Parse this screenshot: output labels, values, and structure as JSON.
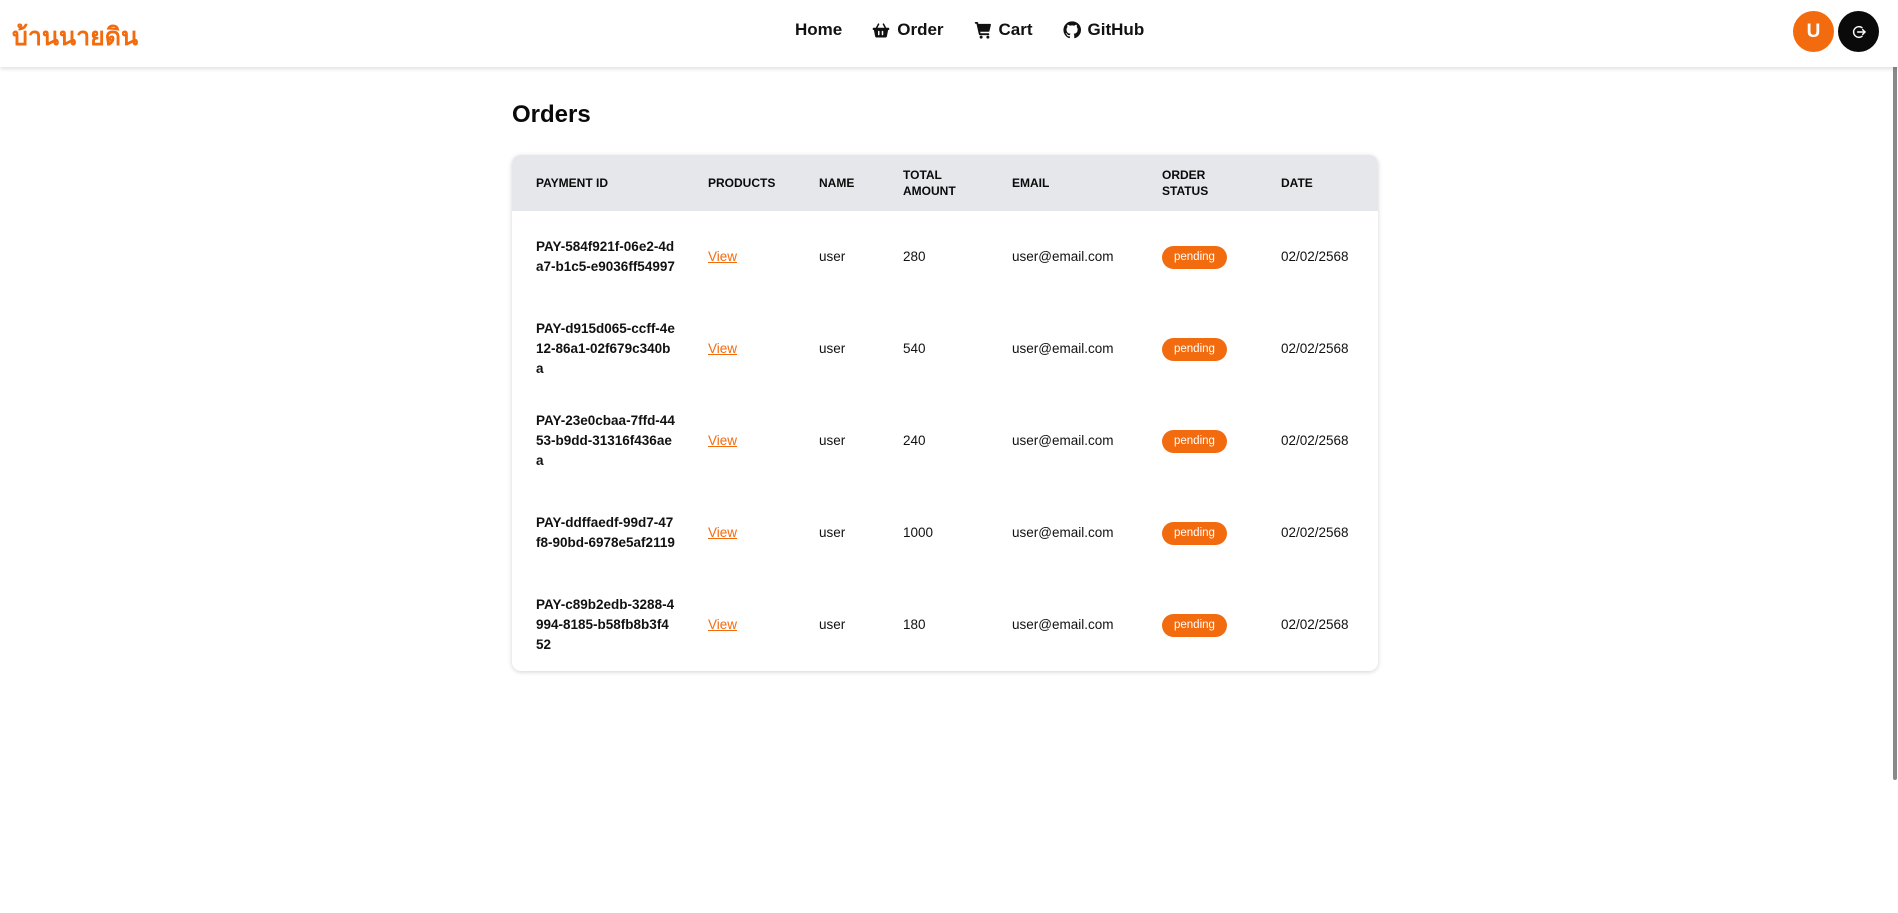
{
  "brand": {
    "name": "บ้านนายดิน",
    "color": "#f26b0f"
  },
  "nav": {
    "items": [
      {
        "label": "Home",
        "icon": ""
      },
      {
        "label": "Order",
        "icon": "basket-icon"
      },
      {
        "label": "Cart",
        "icon": "cart-icon"
      },
      {
        "label": "GitHub",
        "icon": "github-icon"
      }
    ]
  },
  "user": {
    "avatar_letter": "U"
  },
  "page": {
    "title": "Orders"
  },
  "table": {
    "headers": {
      "payment_id": "PAYMENT ID",
      "products": "PRODUCTS",
      "name": "NAME",
      "total_amount": "TOTAL AMOUNT",
      "email": "EMAIL",
      "order_status": "ORDER STATUS",
      "date": "DATE"
    },
    "rows": [
      {
        "payment_id": "PAY-584f921f-06e2-4da7-b1c5-e9036ff54997",
        "products": "View",
        "name": "user",
        "total_amount": "280",
        "email": "user@email.com",
        "order_status": "pending",
        "date": "02/02/2568"
      },
      {
        "payment_id": "PAY-d915d065-ccff-4e12-86a1-02f679c340ba",
        "products": "View",
        "name": "user",
        "total_amount": "540",
        "email": "user@email.com",
        "order_status": "pending",
        "date": "02/02/2568"
      },
      {
        "payment_id": "PAY-23e0cbaa-7ffd-4453-b9dd-31316f436aea",
        "products": "View",
        "name": "user",
        "total_amount": "240",
        "email": "user@email.com",
        "order_status": "pending",
        "date": "02/02/2568"
      },
      {
        "payment_id": "PAY-ddffaedf-99d7-47f8-90bd-6978e5af2119",
        "products": "View",
        "name": "user",
        "total_amount": "1000",
        "email": "user@email.com",
        "order_status": "pending",
        "date": "02/02/2568"
      },
      {
        "payment_id": "PAY-c89b2edb-3288-4994-8185-b58fb8b3f452",
        "products": "View",
        "name": "user",
        "total_amount": "180",
        "email": "user@email.com",
        "order_status": "pending",
        "date": "02/02/2568"
      }
    ]
  },
  "colors": {
    "accent": "#f26b0f",
    "header_bg": "#e5e7eb",
    "logout_bg": "#0a0a0a"
  }
}
